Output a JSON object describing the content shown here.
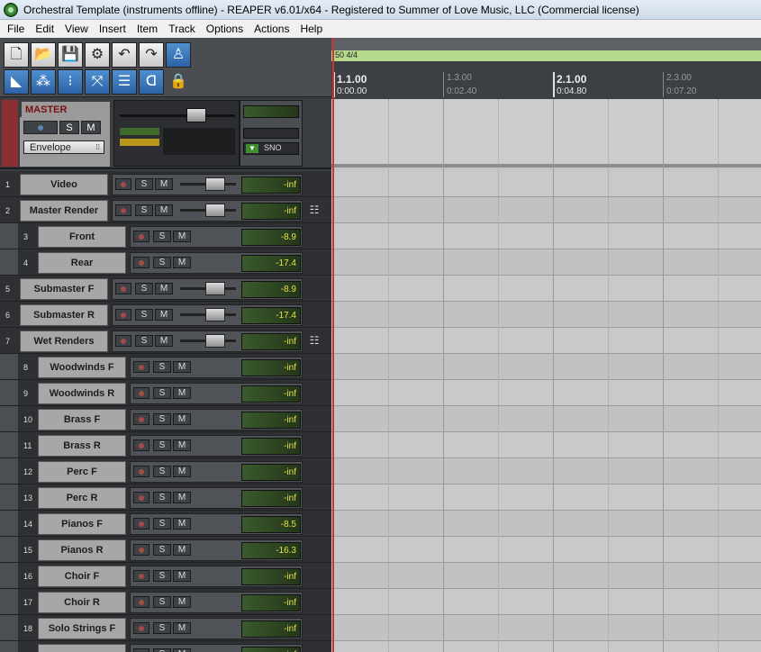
{
  "window": {
    "title": "Orchestral Template (instruments offline) - REAPER v6.01/x64 - Registered to Summer of Love Music, LLC (Commercial license)"
  },
  "menu": [
    "File",
    "Edit",
    "View",
    "Insert",
    "Item",
    "Track",
    "Options",
    "Actions",
    "Help"
  ],
  "master": {
    "name": "MASTER",
    "solo": "S",
    "mute": "M",
    "envelope": "Envelope",
    "mono": "SNO"
  },
  "ruler": {
    "timesig": "50 4/4",
    "marker": "1",
    "bars": [
      {
        "label": "1.1.00",
        "time": "0:00.00",
        "major": true
      },
      {
        "label": "1.3.00",
        "time": "0:02.40",
        "major": false
      },
      {
        "label": "2.1.00",
        "time": "0:04.80",
        "major": true
      },
      {
        "label": "2.3.00",
        "time": "0:07.20",
        "major": false
      }
    ]
  },
  "tracks": [
    {
      "num": "1",
      "name": "Video",
      "level": "-inf",
      "folder": false,
      "child": false
    },
    {
      "num": "2",
      "name": "Master Render",
      "level": "-inf",
      "folder": true,
      "child": false
    },
    {
      "num": "3",
      "name": "Front",
      "level": "-8.9",
      "folder": false,
      "child": true
    },
    {
      "num": "4",
      "name": "Rear",
      "level": "-17.4",
      "folder": false,
      "child": true
    },
    {
      "num": "5",
      "name": "Submaster F",
      "level": "-8.9",
      "folder": false,
      "child": false
    },
    {
      "num": "6",
      "name": "Submaster R",
      "level": "-17.4",
      "folder": false,
      "child": false
    },
    {
      "num": "7",
      "name": "Wet Renders",
      "level": "-inf",
      "folder": true,
      "child": false
    },
    {
      "num": "8",
      "name": "Woodwinds F",
      "level": "-inf",
      "folder": false,
      "child": true
    },
    {
      "num": "9",
      "name": "Woodwinds R",
      "level": "-inf",
      "folder": false,
      "child": true
    },
    {
      "num": "10",
      "name": "Brass F",
      "level": "-inf",
      "folder": false,
      "child": true
    },
    {
      "num": "11",
      "name": "Brass R",
      "level": "-inf",
      "folder": false,
      "child": true
    },
    {
      "num": "12",
      "name": "Perc F",
      "level": "-inf",
      "folder": false,
      "child": true
    },
    {
      "num": "13",
      "name": "Perc R",
      "level": "-inf",
      "folder": false,
      "child": true
    },
    {
      "num": "14",
      "name": "Pianos F",
      "level": "-8.5",
      "folder": false,
      "child": true
    },
    {
      "num": "15",
      "name": "Pianos R",
      "level": "-16.3",
      "folder": false,
      "child": true
    },
    {
      "num": "16",
      "name": "Choir F",
      "level": "-inf",
      "folder": false,
      "child": true
    },
    {
      "num": "17",
      "name": "Choir R",
      "level": "-inf",
      "folder": false,
      "child": true
    },
    {
      "num": "18",
      "name": "Solo Strings F",
      "level": "-inf",
      "folder": false,
      "child": true
    },
    {
      "num": "",
      "name": "",
      "level": "-inf",
      "folder": false,
      "child": true
    }
  ],
  "labels": {
    "solo": "S",
    "mute": "M"
  }
}
